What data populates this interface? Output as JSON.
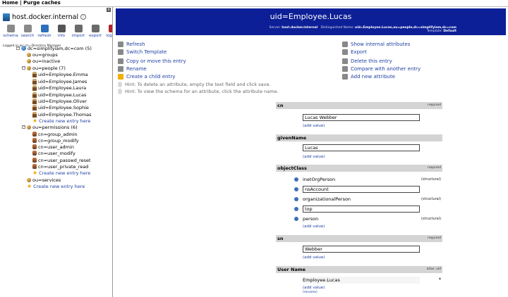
{
  "topbar": {
    "home": "Home",
    "sep": " | ",
    "purge": "Purge caches"
  },
  "tree": {
    "close": "x",
    "server_name": "host.docker.internal",
    "tools": [
      {
        "label": "schema",
        "icon": "schema-icon",
        "color": "#8a8a8a"
      },
      {
        "label": "search",
        "icon": "search-icon",
        "color": "#8a8a8a"
      },
      {
        "label": "refresh",
        "icon": "refresh-icon",
        "color": "#2d6fba"
      },
      {
        "label": "info",
        "icon": "info-icon",
        "color": "#555555"
      },
      {
        "label": "import",
        "icon": "import-icon",
        "color": "#6a6a6a"
      },
      {
        "label": "export",
        "icon": "export-icon",
        "color": "#6a6a6a"
      },
      {
        "label": "logout",
        "icon": "logout-icon",
        "color": "#b0242a"
      }
    ],
    "logged_in": "Logged in as: cn=Directory Manager",
    "nodes": [
      {
        "label": "dc=simplifyiam,dc=com (5)",
        "type": "dc",
        "toggle": "−"
      },
      {
        "label": "ou=groups",
        "type": "ou",
        "toggle": ""
      },
      {
        "label": "ou=inactive",
        "type": "ou",
        "toggle": ""
      },
      {
        "label": "ou=people (7)",
        "type": "ou",
        "toggle": "−"
      },
      {
        "label": "uid=Employee.Emma",
        "type": "user",
        "toggle": ""
      },
      {
        "label": "uid=Employee.James",
        "type": "user",
        "toggle": ""
      },
      {
        "label": "uid=Employee.Laura",
        "type": "user",
        "toggle": ""
      },
      {
        "label": "uid=Employee.Lucas",
        "type": "user",
        "toggle": ""
      },
      {
        "label": "uid=Employee.Oliver",
        "type": "user",
        "toggle": ""
      },
      {
        "label": "uid=Employee.Sophie",
        "type": "user",
        "toggle": ""
      },
      {
        "label": "uid=Employee.Thomas",
        "type": "user",
        "toggle": ""
      },
      {
        "label": "Create new entry here",
        "type": "new",
        "toggle": ""
      },
      {
        "label": "ou=permissions (6)",
        "type": "ou",
        "toggle": "−"
      },
      {
        "label": "cn=group_admin",
        "type": "group",
        "toggle": ""
      },
      {
        "label": "cn=group_modify",
        "type": "group",
        "toggle": ""
      },
      {
        "label": "cn=user_admin",
        "type": "group",
        "toggle": ""
      },
      {
        "label": "cn=user_modify",
        "type": "group",
        "toggle": ""
      },
      {
        "label": "cn=user_passwd_reset",
        "type": "group",
        "toggle": ""
      },
      {
        "label": "cn=user_private_read",
        "type": "group",
        "toggle": ""
      },
      {
        "label": "Create new entry here",
        "type": "new",
        "toggle": ""
      },
      {
        "label": "ou=services",
        "type": "ou",
        "toggle": ""
      },
      {
        "label": "Create new entry here",
        "type": "new",
        "toggle": ""
      }
    ]
  },
  "header": {
    "title": "uid=Employee.Lucas",
    "server_label": "Server:",
    "server": "host.docker.internal",
    "dn_label": "Distinguished Name:",
    "dn": "uid=Employee.Lucas,ou=people,dc=simplifyiam,dc=com",
    "template_label": "Template:",
    "template": "Default"
  },
  "actions_left": [
    {
      "label": "Refresh",
      "icon": "refresh-icon"
    },
    {
      "label": "Switch Template",
      "icon": "switch-template-icon"
    },
    {
      "label": "Copy or move this entry",
      "icon": "copy-icon"
    },
    {
      "label": "Rename",
      "icon": "rename-icon"
    },
    {
      "label": "Create a child entry",
      "icon": "star-icon"
    }
  ],
  "hints": [
    "Hint: To delete an attribute, empty the text field and click save.",
    "Hint: To view the schema for an attribute, click the attribute name."
  ],
  "actions_right": [
    {
      "label": "Show internal attributes",
      "icon": "scissors-icon"
    },
    {
      "label": "Export",
      "icon": "export-icon"
    },
    {
      "label": "Delete this entry",
      "icon": "delete-icon"
    },
    {
      "label": "Compare with another entry",
      "icon": "compare-icon"
    },
    {
      "label": "Add new attribute",
      "icon": "add-attribute-icon"
    }
  ],
  "attributes": {
    "required_label": "required",
    "add_value": "(add value)",
    "structural": "(structural)",
    "cn": {
      "name": "cn",
      "value": "Lucas Webber"
    },
    "givenName": {
      "name": "givenName",
      "value": "Lucas"
    },
    "objectClass": {
      "name": "objectClass",
      "values": [
        "inetOrgPerson",
        "nsAccount",
        "organizationalPerson",
        "top",
        "person"
      ]
    },
    "sn": {
      "name": "sn",
      "value": "Webber"
    },
    "userName": {
      "name": "User Name",
      "alias": "alias: uid",
      "value": "Employee.Lucas",
      "rename": "(rename)"
    }
  }
}
